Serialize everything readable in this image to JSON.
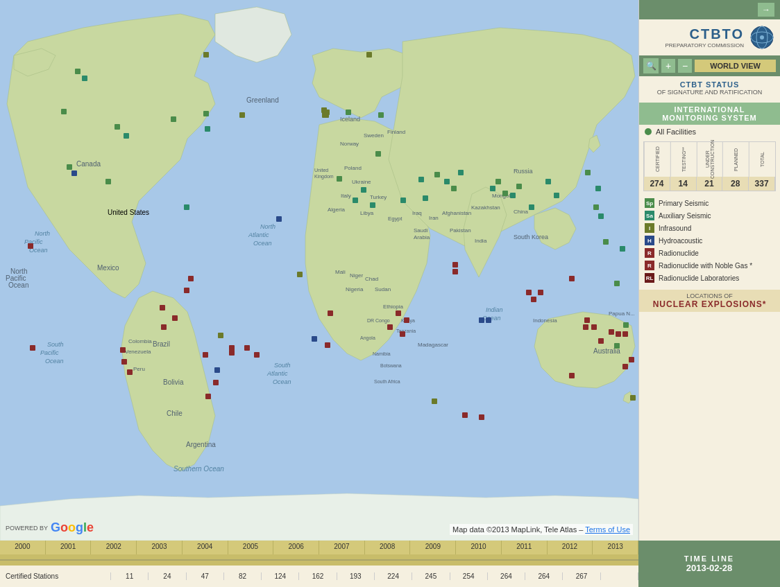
{
  "header": {
    "arrow_label": "→"
  },
  "ctbto": {
    "name": "CTBTO",
    "subtitle": "PREPARATORY COMMISSION",
    "icon": "🌐"
  },
  "search_bar": {
    "world_view_label": "WORLD VIEW",
    "zoom_plus": "+",
    "zoom_minus": "−"
  },
  "ctbt_status": {
    "title": "CTBT STATUS",
    "subtitle": "OF SIGNATURE AND RATIFICATION"
  },
  "ims": {
    "line1": "INTERNATIONAL",
    "line2": "MONITORING SYSTEM"
  },
  "all_facilities": {
    "label": "All Facilities"
  },
  "stats": {
    "headers": [
      "CERTIFIED",
      "TESTING**",
      "UNDER CONSTRUCTION",
      "PLANNED",
      "TOTAL"
    ],
    "values": [
      "274",
      "14",
      "21",
      "28",
      "337"
    ]
  },
  "legend": {
    "items": [
      {
        "color": "green",
        "label": "Primary Seismic"
      },
      {
        "color": "teal",
        "label": "Auxiliary Seismic"
      },
      {
        "color": "olive",
        "label": "Infrasound"
      },
      {
        "color": "blue",
        "label": "Hydroacoustic"
      },
      {
        "color": "red",
        "label": "Radionuclide"
      },
      {
        "color": "red",
        "label": "Radionuclide with Noble Gas *"
      },
      {
        "color": "darkred",
        "label": "Radionuclide Laboratories"
      }
    ]
  },
  "nuclear": {
    "small": "LOCATIONS OF",
    "large": "NUCLEAR EXPLOSIONS*"
  },
  "timeline": {
    "label": "TIME LINE",
    "date": "2013-02-28",
    "years": [
      "2000",
      "2001",
      "2002",
      "2003",
      "2004",
      "2005",
      "2006",
      "2007",
      "2008",
      "2009",
      "2010",
      "2011",
      "2012",
      "2013"
    ],
    "certified_label": "Certified Stations",
    "certified_values": [
      "11",
      "24",
      "47",
      "82",
      "124",
      "162",
      "193",
      "224",
      "245",
      "254",
      "264",
      "264",
      "267",
      ""
    ]
  },
  "map": {
    "attribution": "Map data ©2013 MapLink, Tele Atlas –",
    "terms_link": "Terms of Use",
    "powered_by": "POWERED BY"
  }
}
